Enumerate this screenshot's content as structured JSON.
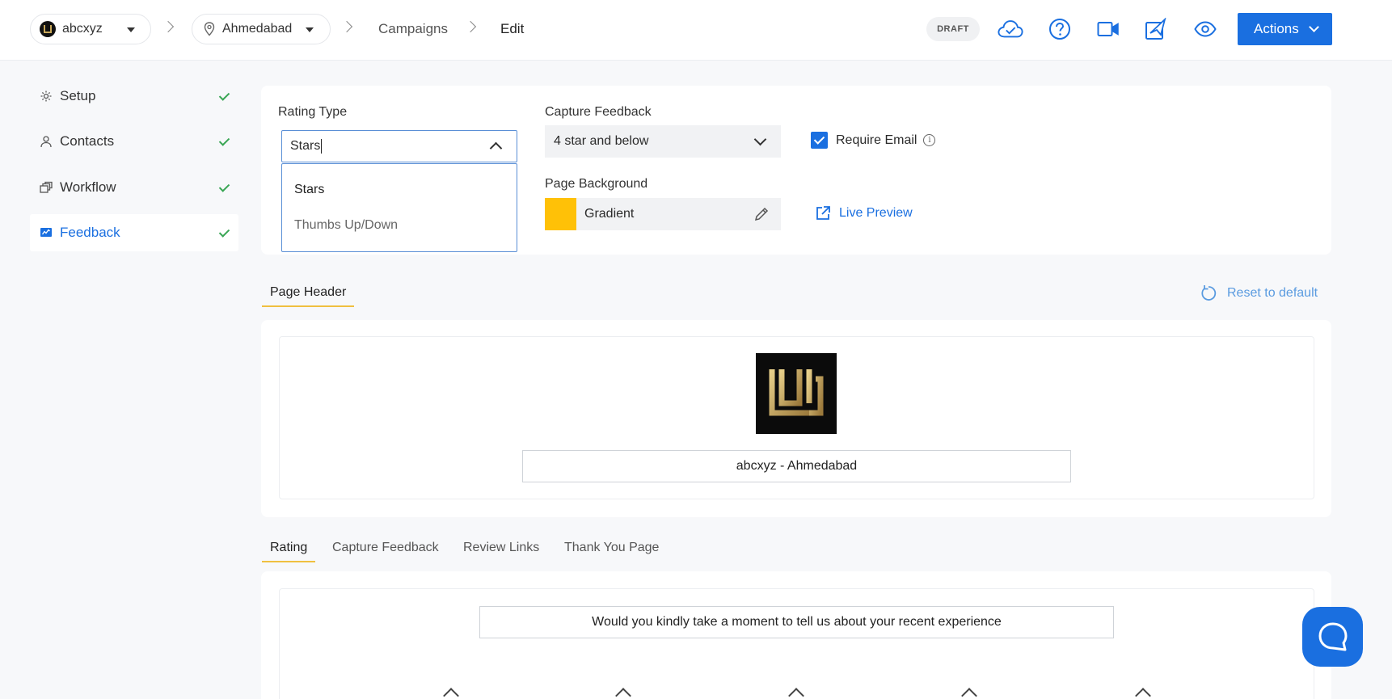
{
  "topbar": {
    "brand": "abcxyz",
    "location": "Ahmedabad",
    "crumb_campaigns": "Campaigns",
    "crumb_edit": "Edit",
    "status": "DRAFT",
    "actions_label": "Actions",
    "icons": [
      "cloud-check-icon",
      "help-icon",
      "video-icon",
      "send-icon",
      "eye-icon"
    ]
  },
  "sidebar": {
    "items": [
      {
        "label": "Setup",
        "icon": "gear-icon",
        "done": true
      },
      {
        "label": "Contacts",
        "icon": "user-icon",
        "done": true
      },
      {
        "label": "Workflow",
        "icon": "workflow-icon",
        "done": true
      },
      {
        "label": "Feedback",
        "icon": "feedback-icon",
        "done": true,
        "active": true
      }
    ]
  },
  "settings": {
    "rating_type_label": "Rating Type",
    "rating_type_value": "Stars",
    "rating_options": [
      "Stars",
      "Thumbs Up/Down"
    ],
    "capture_feedback_label": "Capture Feedback",
    "capture_feedback_value": "4 star and below",
    "require_email_label": "Require Email",
    "require_email_checked": true,
    "page_background_label": "Page Background",
    "page_background_value": "Gradient",
    "page_background_color": "#ffc107",
    "live_preview_label": "Live Preview"
  },
  "page_header": {
    "tab_label": "Page Header",
    "reset_label": "Reset to default",
    "business_name": "abcxyz - Ahmedabad"
  },
  "rating_tabs": [
    "Rating",
    "Capture Feedback",
    "Review Links",
    "Thank You Page"
  ],
  "rating": {
    "question": "Would you kindly take a moment to tell us about your recent experience",
    "stars_count": 5
  },
  "colors": {
    "accent": "#1a6fe0",
    "success": "#3aa655",
    "tab_underline": "#f0c040"
  }
}
